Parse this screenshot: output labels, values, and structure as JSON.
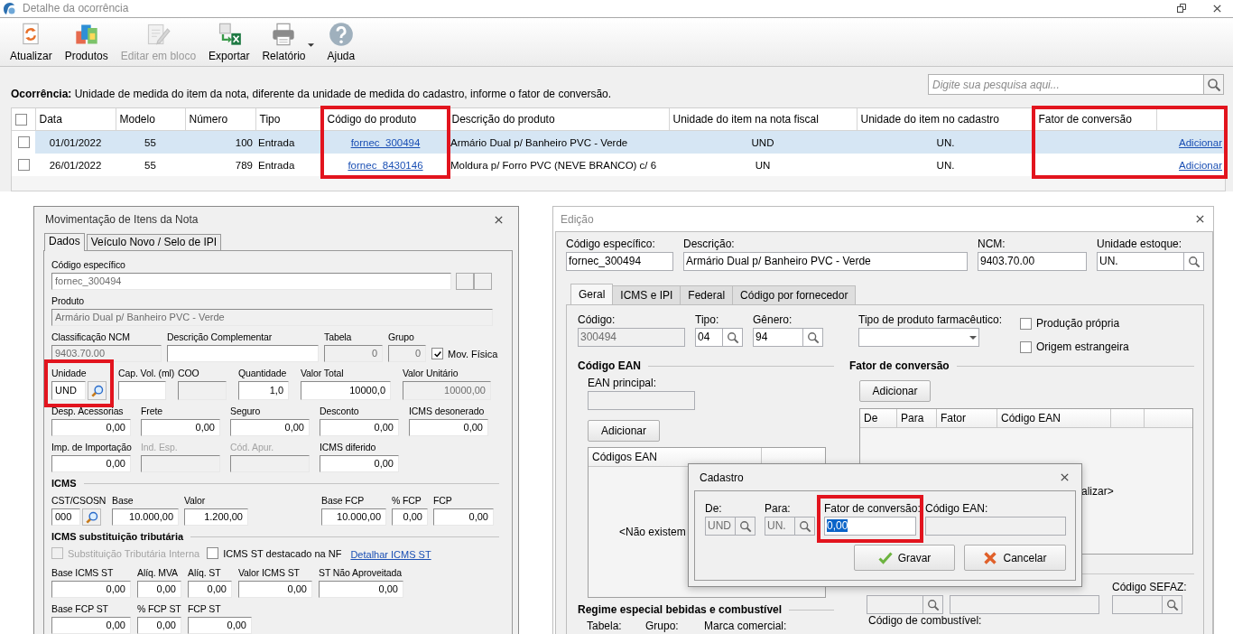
{
  "main_window": {
    "title": "Detalhe da ocorrência"
  },
  "toolbar": [
    {
      "label": "Atualizar",
      "kind": "refresh",
      "disabled": false
    },
    {
      "label": "Produtos",
      "kind": "products",
      "disabled": false
    },
    {
      "label": "Editar em bloco",
      "kind": "edit",
      "disabled": true
    },
    {
      "label": "Exportar",
      "kind": "export",
      "disabled": false
    },
    {
      "label": "Relatório",
      "kind": "print",
      "disabled": false,
      "dropdown": true
    },
    {
      "label": "Ajuda",
      "kind": "help",
      "disabled": false
    }
  ],
  "occurrence": "**Ocorrência:**  Unidade de medida do item da nota, diferente da unidade de medida do cadastro, informe o fator de conversão.",
  "search": {
    "placeholder": "Digite sua pesquisa aqui..."
  },
  "table": {
    "select_all": {
      "checked": false
    },
    "columns": [
      {
        "label": "Data",
        "kind": "center"
      },
      {
        "label": "Modelo",
        "kind": "center"
      },
      {
        "label": "Número",
        "kind": "number"
      },
      {
        "label": "Tipo",
        "kind": "text"
      },
      {
        "label": "Código do produto",
        "kind": "link",
        "highlighted": true
      },
      {
        "label": "Descrição do produto",
        "kind": "text"
      },
      {
        "label": "Unidade do item na nota fiscal",
        "kind": "center"
      },
      {
        "label": "Unidade do item no cadastro",
        "kind": "center"
      },
      {
        "label": "Fator de conversão",
        "kind": "text",
        "highlighted": true
      },
      {
        "kind": "action",
        "highlighted": true
      }
    ],
    "rows": [
      {
        "selected": true,
        "checked": false,
        "cells": [
          "01/01/2022",
          "55",
          "100",
          "Entrada",
          "fornec_300494",
          "Armário Dual p/ Banheiro PVC - Verde",
          "UND",
          "UN.",
          null,
          "Adicionar"
        ]
      },
      {
        "selected": false,
        "checked": false,
        "cells": [
          "26/01/2022",
          "55",
          "789",
          "Entrada",
          "fornec_8430146",
          "Moldura p/ Forro PVC (NEVE BRANCO) c/ 6",
          "UN",
          "UN.",
          null,
          "Adicionar"
        ]
      }
    ]
  },
  "items_dialog": {
    "title": "Movimentação de Itens da Nota",
    "tabs": [
      {
        "label": "Dados",
        "selected": true
      },
      {
        "label": "Veículo Novo / Selo de IPI",
        "selected": false
      }
    ],
    "rows": [
      {
        "kind": "fields",
        "items": [
          {
            "label": "Código específico",
            "kind": "text",
            "value": "fornec_300494",
            "dimmed": true
          },
          {
            "kind": "buttons"
          }
        ]
      },
      {
        "kind": "fields",
        "items": [
          {
            "label": "Produto",
            "kind": "text",
            "value": "Armário Dual p/ Banheiro PVC - Verde",
            "readonly": true
          }
        ]
      },
      {
        "kind": "fields",
        "items": [
          {
            "label": "Classificação NCM",
            "kind": "text",
            "value": "9403.70.00",
            "readonly": true
          },
          {
            "label": "Descrição Complementar",
            "kind": "text"
          },
          {
            "label": "Tabela",
            "kind": "number",
            "value": "0",
            "readonly": true
          },
          {
            "label": "Grupo",
            "kind": "number",
            "value": "0",
            "readonly": true
          },
          {
            "label": "Mov. Física",
            "kind": "check",
            "checked": true
          }
        ]
      },
      {
        "kind": "fields",
        "items": [
          {
            "label": "Unidade",
            "kind": "lookup",
            "value": "UND",
            "highlighted": true
          },
          {
            "label": "Cap. Vol. (ml)",
            "kind": "text"
          },
          {
            "label": "COO",
            "kind": "text",
            "readonly": true
          },
          {
            "label": "Quantidade",
            "kind": "number",
            "value": "1,0"
          },
          {
            "label": "Valor Total",
            "kind": "number",
            "value": "10000,0"
          },
          {
            "label": "Valor Unitário",
            "kind": "number",
            "value": "10000,00",
            "readonly": true
          }
        ]
      },
      {
        "kind": "fields",
        "items": [
          {
            "label": "Desp. Acessorias",
            "kind": "number",
            "value": "0,00"
          },
          {
            "label": "Frete",
            "kind": "number",
            "value": "0,00"
          },
          {
            "label": "Seguro",
            "kind": "number",
            "value": "0,00"
          },
          {
            "label": "Desconto",
            "kind": "number",
            "value": "0,00"
          },
          {
            "label": "ICMS desonerado",
            "kind": "number",
            "value": "0,00"
          }
        ]
      },
      {
        "kind": "fields",
        "items": [
          {
            "label": "Imp. de Importação",
            "kind": "number",
            "value": "0,00"
          },
          {
            "label": "Ind. Esp.",
            "kind": "text",
            "disabled": true
          },
          {
            "label": "Cód. Apur.",
            "kind": "text",
            "disabled": true
          },
          {
            "label": "ICMS diferido",
            "kind": "number",
            "value": "0,00"
          }
        ]
      },
      {
        "kind": "heading",
        "label": "ICMS"
      },
      {
        "kind": "fields",
        "items": [
          {
            "label": "CST/CSOSN",
            "kind": "lookup",
            "value": "000"
          },
          {
            "label": "Base",
            "kind": "number",
            "value": "10.000,00"
          },
          {
            "label": "Valor",
            "kind": "number",
            "value": "1.200,00"
          },
          {
            "label": "Base FCP",
            "kind": "number",
            "value": "10.000,00"
          },
          {
            "label": "% FCP",
            "kind": "number",
            "value": "0,00"
          },
          {
            "label": "FCP",
            "kind": "number",
            "value": "0,00"
          }
        ]
      },
      {
        "kind": "heading",
        "label": "ICMS substituição tributária"
      },
      {
        "kind": "checks",
        "items": [
          {
            "label": "Substituição Tributária Interna",
            "kind": "check",
            "checked": false,
            "disabled": true
          },
          {
            "label": "ICMS ST destacado na NF",
            "kind": "check",
            "checked": false,
            "disabled": false
          },
          {
            "label": "Detalhar ICMS ST",
            "kind": "link"
          }
        ]
      },
      {
        "kind": "fields",
        "items": [
          {
            "label": "Base ICMS ST",
            "kind": "number",
            "value": "0,00"
          },
          {
            "label": "Alíq. MVA",
            "kind": "number",
            "value": "0,00"
          },
          {
            "label": "Alíq. ST",
            "kind": "number",
            "value": "0,00"
          },
          {
            "label": "Valor ICMS ST",
            "kind": "number",
            "value": "0,00"
          },
          {
            "label": "ST Não Aproveitada",
            "kind": "number",
            "value": "0,00"
          }
        ]
      },
      {
        "kind": "fields",
        "items": [
          {
            "label": "Base FCP ST",
            "kind": "number",
            "value": "0,00"
          },
          {
            "label": "% FCP ST",
            "kind": "number",
            "value": "0,00"
          },
          {
            "label": "FCP ST",
            "kind": "number",
            "value": "0,00"
          }
        ]
      }
    ]
  },
  "edit_dialog": {
    "title": "Edição",
    "header": [
      {
        "label": "Código específico:",
        "kind": "text",
        "value": "fornec_300494"
      },
      {
        "label": "Descrição:",
        "kind": "text",
        "value": "Armário Dual p/ Banheiro PVC - Verde"
      },
      {
        "label": "NCM:",
        "kind": "text",
        "value": "9403.70.00"
      },
      {
        "label": "Unidade estoque:",
        "kind": "lookup",
        "value": "UN."
      }
    ],
    "tabs": [
      {
        "label": "Geral",
        "selected": true
      },
      {
        "label": "ICMS e IPI",
        "selected": false
      },
      {
        "label": "Federal",
        "selected": false
      },
      {
        "label": "Código por fornecedor",
        "selected": false
      }
    ],
    "general": [
      {
        "label": "Código:",
        "kind": "text",
        "value": "300494",
        "readonly": true
      },
      {
        "label": "Tipo:",
        "kind": "lookup",
        "value": "04"
      },
      {
        "label": "Gênero:",
        "kind": "lookup",
        "value": "94"
      },
      {
        "label": "Tipo de produto farmacêutico:",
        "kind": "select"
      }
    ],
    "options": [
      {
        "label": "Produção própria",
        "kind": "check",
        "checked": false
      },
      {
        "label": "Origem estrangeira",
        "kind": "check",
        "checked": false
      }
    ],
    "ean": {
      "heading": "Código EAN",
      "principal": {
        "label": "EAN principal:",
        "kind": "text",
        "readonly": true
      },
      "button": "Adicionar",
      "columns": [
        "Códigos EAN"
      ],
      "empty_text": "<Não existem"
    },
    "conversion": {
      "heading": "Fator de conversão",
      "button": "Adicionar",
      "columns": [
        "De",
        "Para",
        "Fator",
        "Código EAN"
      ],
      "empty_text": "alizar>"
    },
    "lower": [
      {
        "kind": "lookup",
        "readonly": true
      },
      {
        "kind": "text",
        "readonly": true
      },
      {
        "label": "Código SEFAZ:",
        "kind": "lookup",
        "readonly": true
      }
    ],
    "fuel": {
      "heading": "Regime especial bebidas e combustível",
      "labels": [
        "Tabela:",
        "Grupo:",
        "Marca comercial:"
      ]
    },
    "fuel_code_label": "Código de combustível:"
  },
  "cadastro_dialog": {
    "title": "Cadastro",
    "fields": [
      {
        "label": "De:",
        "kind": "lookup",
        "value": "UND",
        "readonly": true
      },
      {
        "label": "Para:",
        "kind": "lookup",
        "value": "UN.",
        "readonly": true
      },
      {
        "label": "Fator de conversão:",
        "kind": "text",
        "value": "0,00",
        "highlighted": true,
        "text_selected": true
      },
      {
        "label": "Código EAN:",
        "kind": "text",
        "readonly": true
      }
    ],
    "buttons": [
      {
        "label": "Gravar",
        "kind": "save"
      },
      {
        "label": "Cancelar",
        "kind": "cancel"
      }
    ]
  }
}
